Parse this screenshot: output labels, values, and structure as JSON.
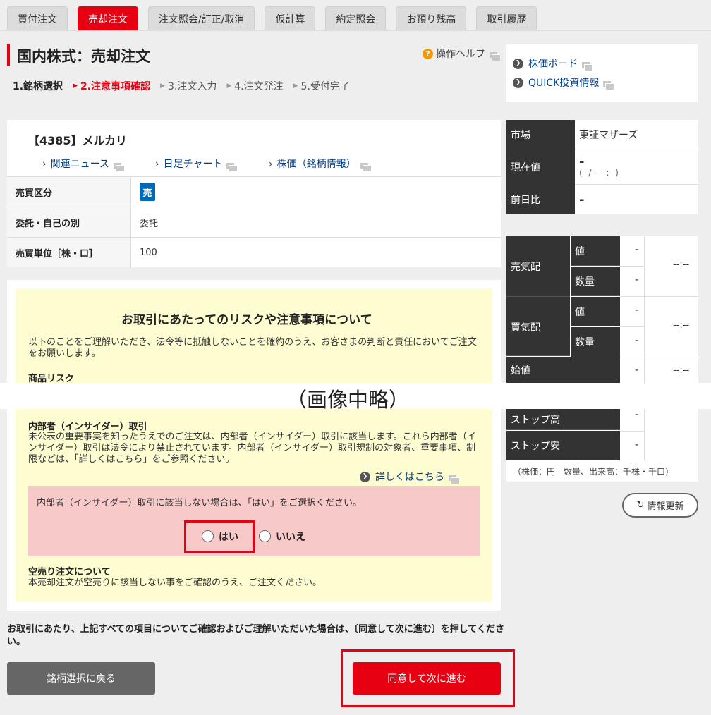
{
  "tabs": [
    "買付注文",
    "売却注文",
    "注文照会/訂正/取消",
    "仮計算",
    "約定照会",
    "お預り残高",
    "取引履歴"
  ],
  "page_title": "国内株式：売却注文",
  "help_label": "操作ヘルプ",
  "steps": [
    "1.銘柄選択",
    "2.注意事項確認",
    "3.注文入力",
    "4.注文発注",
    "5.受付完了"
  ],
  "side_links": [
    "株価ボード",
    "QUICK投資情報"
  ],
  "stock": {
    "name": "【4385】メルカリ",
    "links": [
      "関連ニュース",
      "日足チャート",
      "株価（銘柄情報）"
    ],
    "rows": [
      {
        "label": "売買区分",
        "value": "売"
      },
      {
        "label": "委託・自己の別",
        "value": "委託"
      },
      {
        "label": "売買単位［株・口］",
        "value": "100"
      }
    ]
  },
  "notice": {
    "title": "お取引にあたってのリスクや注意事項について",
    "intro": "以下のことをご理解いただき、法令等に抵触しないことを確約のうえ、お客さまの判断と責任においてご注文をお願いします。",
    "product_risk": "商品リスク",
    "omitted": "（画像中略）",
    "insider_head": "内部者（インサイダー）取引",
    "insider_text": "未公表の重要事実を知ったうえでのご注文は、内部者（インサイダー）取引に該当します。これら内部者（インサイダー）取引は法令により禁止されています。内部者（インサイダー）取引規制の対象者、重要事項、制限などは、「詳しくはこちら」をご参照ください。",
    "detail_link": "詳しくはこちら",
    "question": "内部者（インサイダー）取引に該当しない場合は、「はい」をご選択ください。",
    "yes": "はい",
    "no": "いいえ",
    "short_head": "空売り注文について",
    "short_text": "本売却注文が空売りに該当しない事をご確認のうえ、ご注文ください。"
  },
  "confirm_text": "お取引にあたり、上記すべての項目についてご確認およびご理解いただいた場合は、〔同意して次に進む〕を押してください。",
  "buttons": {
    "back": "銘柄選択に戻る",
    "next": "同意して次に進む",
    "refresh": "情報更新"
  },
  "quote": {
    "market_label": "市場",
    "market": "東証マザーズ",
    "price_label": "現在値",
    "price": "-",
    "price_time": "(--/-- --:--)",
    "change_label": "前日比",
    "change": "-",
    "ask_label": "売気配",
    "bid_label": "買気配",
    "value_label": "値",
    "qty_label": "数量",
    "dash": "-",
    "time_dash": "--:--",
    "open_label": "始値",
    "stop_high_label": "ストップ高",
    "stop_low_label": "ストップ安",
    "units_note": "（株価：円　数量、出来高：千株・千口）"
  }
}
